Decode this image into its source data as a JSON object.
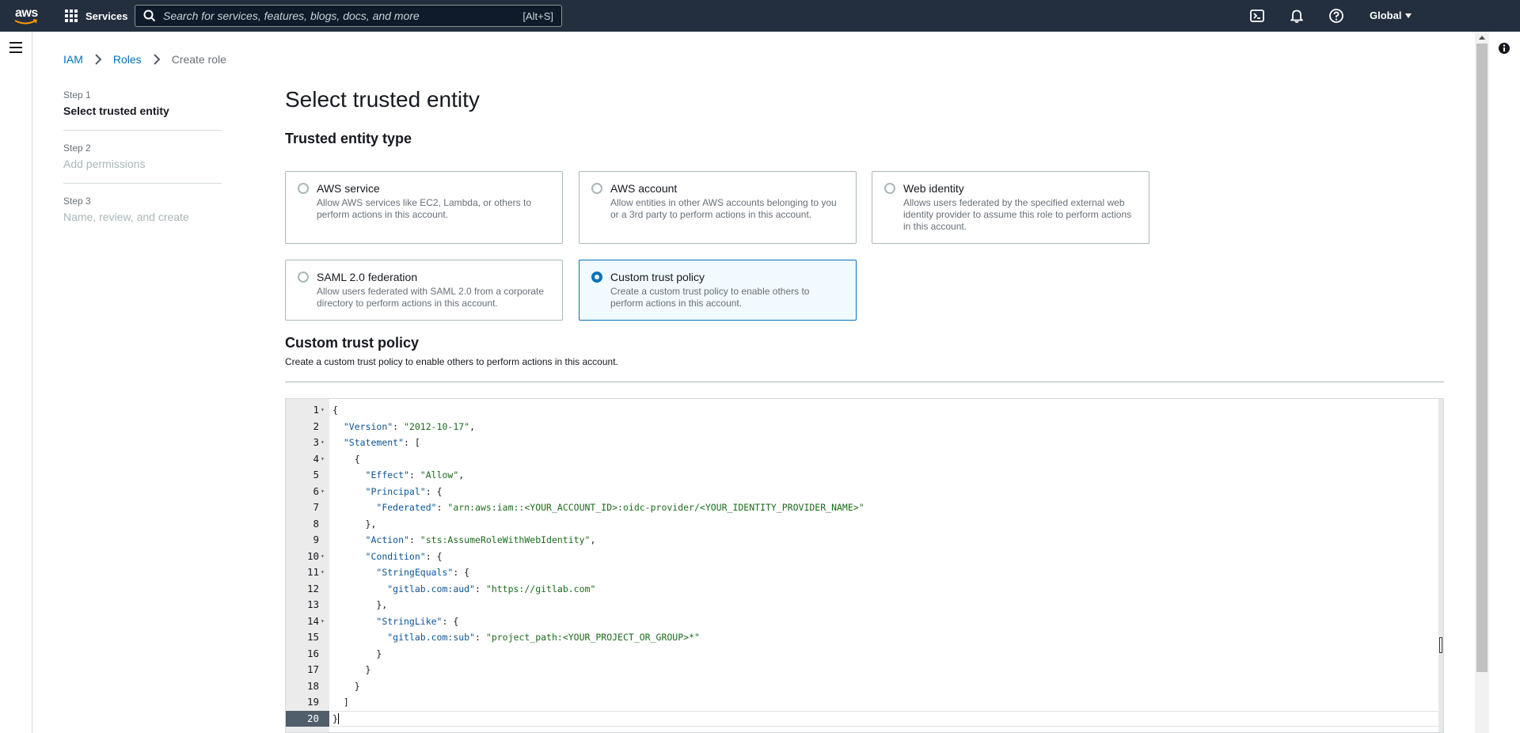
{
  "topnav": {
    "logo_text": "aws",
    "services_label": "Services",
    "search_placeholder": "Search for services, features, blogs, docs, and more",
    "search_shortcut": "[Alt+S]",
    "region_label": "Global",
    "bg_color": "#232f3e"
  },
  "breadcrumb": {
    "items": [
      "IAM",
      "Roles"
    ],
    "current": "Create role"
  },
  "steps": [
    {
      "num": "Step 1",
      "title": "Select trusted entity",
      "active": true
    },
    {
      "num": "Step 2",
      "title": "Add permissions",
      "active": false
    },
    {
      "num": "Step 3",
      "title": "Name, review, and create",
      "active": false
    }
  ],
  "main": {
    "title": "Select trusted entity",
    "section_title": "Trusted entity type",
    "tiles": [
      {
        "title": "AWS service",
        "desc": "Allow AWS services like EC2, Lambda, or others to perform actions in this account.",
        "selected": false
      },
      {
        "title": "AWS account",
        "desc": "Allow entities in other AWS accounts belonging to you or a 3rd party to perform actions in this account.",
        "selected": false
      },
      {
        "title": "Web identity",
        "desc": "Allows users federated by the specified external web identity provider to assume this role to perform actions in this account.",
        "selected": false
      },
      {
        "title": "SAML 2.0 federation",
        "desc": "Allow users federated with SAML 2.0 from a corporate directory to perform actions in this account.",
        "selected": false
      },
      {
        "title": "Custom trust policy",
        "desc": "Create a custom trust policy to enable others to perform actions in this account.",
        "selected": true
      }
    ],
    "custom_policy_title": "Custom trust policy",
    "custom_policy_desc": "Create a custom trust policy to enable others to perform actions in this account."
  },
  "editor": {
    "current_line": 20,
    "lines": [
      {
        "n": "1",
        "fold": true,
        "text": "{"
      },
      {
        "n": "2",
        "fold": false,
        "text": "  \"Version\": \"2012-10-17\","
      },
      {
        "n": "3",
        "fold": true,
        "text": "  \"Statement\": ["
      },
      {
        "n": "4",
        "fold": true,
        "text": "    {"
      },
      {
        "n": "5",
        "fold": false,
        "text": "      \"Effect\": \"Allow\","
      },
      {
        "n": "6",
        "fold": true,
        "text": "      \"Principal\": {"
      },
      {
        "n": "7",
        "fold": false,
        "text": "        \"Federated\": \"arn:aws:iam::<YOUR_ACCOUNT_ID>:oidc-provider/<YOUR_IDENTITY_PROVIDER_NAME>\""
      },
      {
        "n": "8",
        "fold": false,
        "text": "      },"
      },
      {
        "n": "9",
        "fold": false,
        "text": "      \"Action\": \"sts:AssumeRoleWithWebIdentity\","
      },
      {
        "n": "10",
        "fold": true,
        "text": "      \"Condition\": {"
      },
      {
        "n": "11",
        "fold": true,
        "text": "        \"StringEquals\": {"
      },
      {
        "n": "12",
        "fold": false,
        "text": "          \"gitlab.com:aud\": \"https://gitlab.com\""
      },
      {
        "n": "13",
        "fold": false,
        "text": "        },"
      },
      {
        "n": "14",
        "fold": true,
        "text": "        \"StringLike\": {"
      },
      {
        "n": "15",
        "fold": false,
        "text": "          \"gitlab.com:sub\": \"project_path:<YOUR_PROJECT_OR_GROUP>*\""
      },
      {
        "n": "16",
        "fold": false,
        "text": "        }"
      },
      {
        "n": "17",
        "fold": false,
        "text": "      }"
      },
      {
        "n": "18",
        "fold": false,
        "text": "    }"
      },
      {
        "n": "19",
        "fold": false,
        "text": "  ]"
      },
      {
        "n": "20",
        "fold": false,
        "text": "}"
      }
    ]
  },
  "colors": {
    "link": "#0073bb",
    "selected_tile_bg": "#f1faff",
    "json_key": "#0b5394",
    "json_string": "#1c6b1c"
  },
  "icons": [
    "aws-logo-icon",
    "services-grid-icon",
    "search-icon",
    "cloudshell-icon",
    "bell-icon",
    "help-icon",
    "caret-down-icon",
    "hamburger-icon",
    "info-icon",
    "chevron-right-icon",
    "fold-arrow-icon"
  ]
}
